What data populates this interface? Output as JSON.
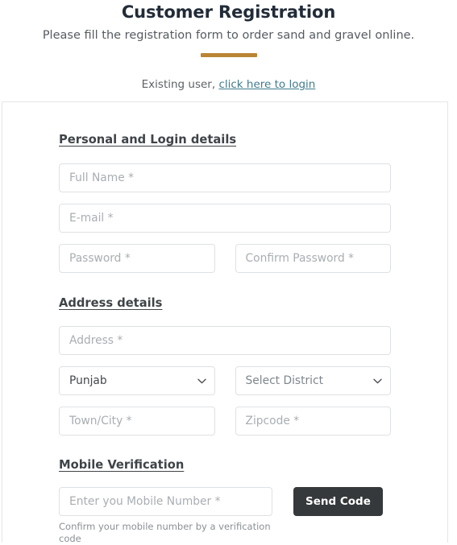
{
  "header": {
    "title": "Customer Registration",
    "subtitle": "Please fill the registration form to order sand and gravel online.",
    "divider_color": "#bb8435",
    "login_prompt": "Existing user,",
    "login_link_label": "click here to login",
    "login_link_color": "#3f7c8d"
  },
  "form": {
    "sections": {
      "personal": {
        "heading": "Personal and Login details",
        "fields": {
          "full_name": {
            "placeholder": "Full Name *",
            "value": ""
          },
          "email": {
            "placeholder": "E-mail *",
            "value": ""
          },
          "password": {
            "placeholder": "Password *",
            "value": ""
          },
          "confirm_password": {
            "placeholder": "Confirm Password *",
            "value": ""
          }
        }
      },
      "address": {
        "heading": "Address details",
        "fields": {
          "address": {
            "placeholder": "Address *",
            "value": ""
          },
          "state": {
            "selected": "Punjab",
            "is_placeholder": false
          },
          "district": {
            "selected": "Select District",
            "is_placeholder": true
          },
          "town_city": {
            "placeholder": "Town/City *",
            "value": ""
          },
          "zipcode": {
            "placeholder": "Zipcode *",
            "value": ""
          }
        }
      },
      "mobile": {
        "heading": "Mobile Verification",
        "fields": {
          "mobile_number": {
            "placeholder": "Enter you Mobile Number *",
            "value": ""
          }
        },
        "send_code_label": "Send Code",
        "helper_text": "Confirm your mobile number by a verification code",
        "button_color": "#36393b"
      }
    }
  },
  "icons": {
    "chevron_down": "chevron-down-icon"
  }
}
